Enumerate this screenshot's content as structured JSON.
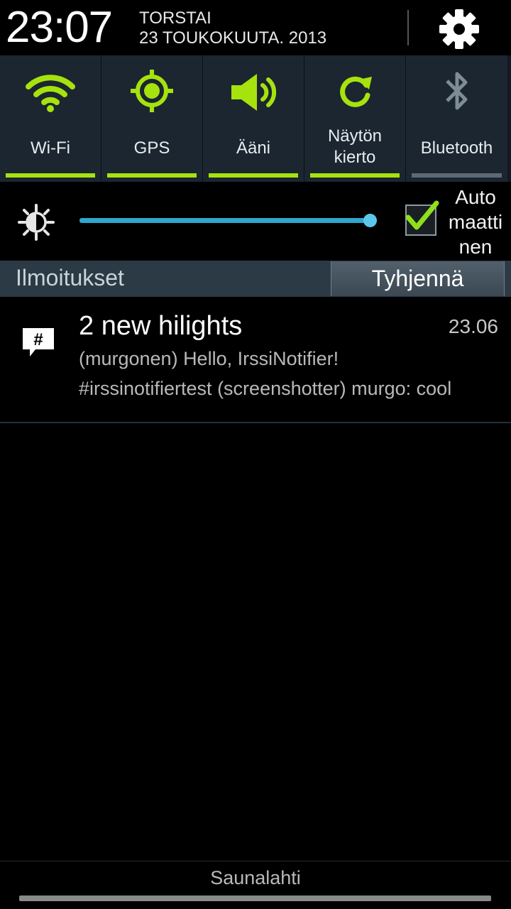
{
  "header": {
    "time": "23:07",
    "day": "TORSTAI",
    "date": "23 TOUKOKUUTA. 2013",
    "settings_icon": "gear-icon"
  },
  "toggles": [
    {
      "label": "Wi-Fi",
      "icon": "wifi-icon",
      "on": true
    },
    {
      "label": "GPS",
      "icon": "gps-icon",
      "on": true
    },
    {
      "label": "Ääni",
      "icon": "speaker-icon",
      "on": true
    },
    {
      "label": "Näytön kierto",
      "icon": "rotate-icon",
      "on": true
    },
    {
      "label": "Bluetooth",
      "icon": "bluetooth-icon",
      "on": false
    }
  ],
  "brightness": {
    "icon": "brightness-icon",
    "level": 0.98,
    "auto_label": "Automaattinen",
    "auto_checked": true
  },
  "notifications": {
    "title": "Ilmoitukset",
    "clear_label": "Tyhjennä",
    "items": [
      {
        "icon": "hash-chat-icon",
        "title": "2 new hilights",
        "time": "23.06",
        "line1": "(murgonen) Hello, IrssiNotifier!",
        "line2": "#irssinotifiertest (screenshotter) murgo: cool"
      }
    ]
  },
  "footer": {
    "carrier": "Saunalahti"
  },
  "colors": {
    "accent_on": "#a6e20e",
    "accent_off": "#5d6a74",
    "slider": "#2fa6cf",
    "check": "#8ee01a"
  }
}
